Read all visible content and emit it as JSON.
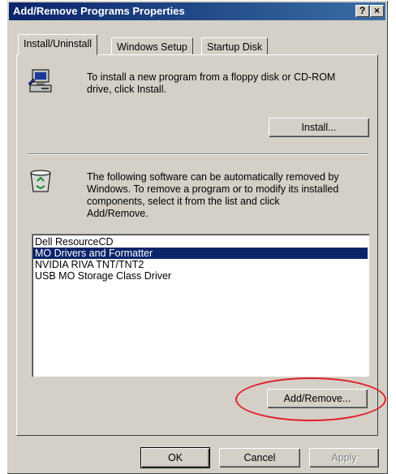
{
  "window": {
    "title": "Add/Remove Programs Properties",
    "help_button": "?",
    "close_button": "×"
  },
  "tabs": [
    {
      "label": "Install/Uninstall",
      "active": true
    },
    {
      "label": "Windows Setup",
      "active": false
    },
    {
      "label": "Startup Disk",
      "active": false
    }
  ],
  "install": {
    "text_line1": "To install a new program from a floppy disk or CD-ROM",
    "text_line2": "drive, click Install.",
    "button_label": "Install...",
    "icon": "computer-install-icon"
  },
  "uninstall": {
    "text_line1": "The following software can be automatically removed by",
    "text_line2": "Windows. To remove a program or to modify its installed",
    "text_line3": "components, select it from the list and click",
    "text_line4": "Add/Remove.",
    "icon": "recycle-bin-icon"
  },
  "programs": {
    "items": [
      "Dell ResourceCD",
      "MO Drivers and Formatter",
      "NVIDIA RIVA TNT/TNT2",
      "USB MO Storage Class Driver"
    ],
    "selected_index": 1
  },
  "add_remove_button": "Add/Remove...",
  "footer": {
    "ok": "OK",
    "cancel": "Cancel",
    "apply": "Apply"
  },
  "colors": {
    "highlight": "#0a246a",
    "annotation_ring": "#e0202a"
  }
}
